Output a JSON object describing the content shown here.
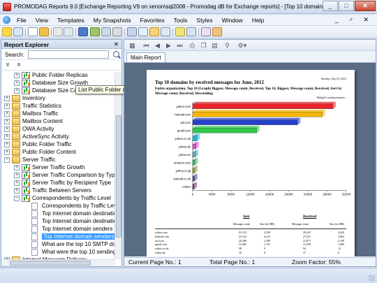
{
  "window": {
    "title": "PROMODAG Reports 9.0 [Exchange Reporting V9 on xenon\\sql2008 - Promodag dB for Exchange reports] - [Top 10 domains...",
    "minimize": "_",
    "maximize": "□",
    "close": "✕"
  },
  "menu": {
    "items": [
      "File",
      "View",
      "Templates",
      "My Snapshots",
      "Favorites",
      "Tools",
      "Styles",
      "Window",
      "Help"
    ],
    "mdi_controls": "_ ♂ ✕"
  },
  "explorer": {
    "title": "Report Explorer",
    "close": "✕",
    "search_label": "Search:",
    "search_value": "",
    "expand_all": "»",
    "collapse_all": "«",
    "tooltip": "List Public Folder replicas",
    "tree": [
      {
        "label": "Public Folder Replicas",
        "icon": "chart",
        "expander": "+"
      },
      {
        "label": "Database Size Growth",
        "icon": "chart",
        "expander": "+"
      },
      {
        "label": "Database Size Comparison",
        "icon": "chart",
        "expander": "+"
      },
      {
        "label": "Inventory",
        "icon": "folder",
        "expander": "+"
      },
      {
        "label": "Traffic Statistics",
        "icon": "folder",
        "expander": "+"
      },
      {
        "label": "Mailbox Traffic",
        "icon": "folder",
        "expander": "+"
      },
      {
        "label": "Mailbox Content",
        "icon": "folder",
        "expander": "+"
      },
      {
        "label": "OWA Activity",
        "icon": "folder",
        "expander": "+"
      },
      {
        "label": "ActiveSync Activity",
        "icon": "folder",
        "expander": "+"
      },
      {
        "label": "Public Folder Traffic",
        "icon": "folder",
        "expander": "+"
      },
      {
        "label": "Public Folder Content",
        "icon": "folder",
        "expander": "+"
      },
      {
        "label": "Server Traffic",
        "icon": "folder",
        "expander": "−"
      },
      {
        "label": "Server Traffic Growth",
        "icon": "chart",
        "expander": "+"
      },
      {
        "label": "Server Traffic Comparison by Type",
        "icon": "chart",
        "expander": "+"
      },
      {
        "label": "Server Traffic by Recipient Type",
        "icon": "chart",
        "expander": "+"
      },
      {
        "label": "Traffic Between Servers",
        "icon": "chart",
        "expander": "+"
      },
      {
        "label": "Correspondents by Traffic Level",
        "icon": "chart",
        "expander": "−"
      },
      {
        "label": "Correspondents by Traffic Level",
        "icon": "doc",
        "expander": ""
      },
      {
        "label": "Top Internet domain destination",
        "icon": "doc",
        "expander": ""
      },
      {
        "label": "Top Internet domain destination",
        "icon": "doc",
        "expander": ""
      },
      {
        "label": "Top Internet domain senders by",
        "icon": "doc",
        "expander": ""
      },
      {
        "label": "Top Internet domain senders by",
        "icon": "doc",
        "expander": "",
        "selected": true
      },
      {
        "label": "What are the top 10 SMTP dom",
        "icon": "doc",
        "expander": ""
      },
      {
        "label": "What were the top 10 sending S",
        "icon": "doc",
        "expander": ""
      },
      {
        "label": "Internal Message Delivery",
        "icon": "folder",
        "expander": "+"
      }
    ]
  },
  "report": {
    "tab_label": "Main Report",
    "page_date": "Tuesday, July 03, 2012",
    "title": "Top 10 domains by received messages for June, 2012",
    "subtitle": "Entire organization, Top 10 (Graph) Biggest, Message count, Received, Top 10, Biggest, Message count, Received, Sort by Message count, Received, Descending",
    "sort_note": "Multiple sending domain :"
  },
  "chart_data": {
    "type": "bar",
    "orientation": "horizontal",
    "categories": [
      "yahoo.com",
      "hotmail.com",
      "aol.com",
      "gmail.com",
      "yahoo.co.uk",
      "yahoo.de",
      "yahoo.es",
      "amazon.com",
      "yahoo.co.jp",
      "hotmail.co.uk",
      "+Other"
    ],
    "values": [
      29241,
      27031,
      21871,
      13338,
      900,
      700,
      600,
      500,
      450,
      400,
      300
    ],
    "bar_colors": [
      "#e8262b",
      "#f6b500",
      "#2540c8",
      "#2ec84a",
      "#20b4d8",
      "#d74bd0",
      "#5aa7c4",
      "#39b56a",
      "#96a234",
      "#4a4aa8",
      "#7a3a78"
    ],
    "xlim": [
      0,
      32000
    ],
    "xticks": [
      "0",
      "4000",
      "8000",
      "12000",
      "16000",
      "20000",
      "24000",
      "28000",
      "32000"
    ],
    "legend": "none",
    "grid": false
  },
  "table": {
    "groups": [
      "Sent",
      "Received"
    ],
    "columns": [
      "Message count",
      "Size (in MB)",
      "Message count",
      "Size (in MB)"
    ],
    "rows": [
      [
        "yahoo.com",
        "21,114",
        "2,320",
        "29,241",
        "4,620"
      ],
      [
        "hotmail.com",
        "23,152",
        "4,213",
        "27,031",
        "3,062"
      ],
      [
        "aol.com",
        "20,306",
        "2,189",
        "21,871",
        "2,199"
      ],
      [
        "gmail.com",
        "12,482",
        "1,741",
        "13,338",
        "1,686"
      ],
      [
        "yahoo.co.uk",
        "38",
        "0",
        "94",
        "12"
      ],
      [
        "yahoo.de",
        "10",
        "0",
        "37",
        "0"
      ]
    ]
  },
  "status": {
    "current_page": "Current Page No.: 1",
    "total_page": "Total Page No.: 1",
    "zoom": "Zoom Factor: 55%"
  }
}
